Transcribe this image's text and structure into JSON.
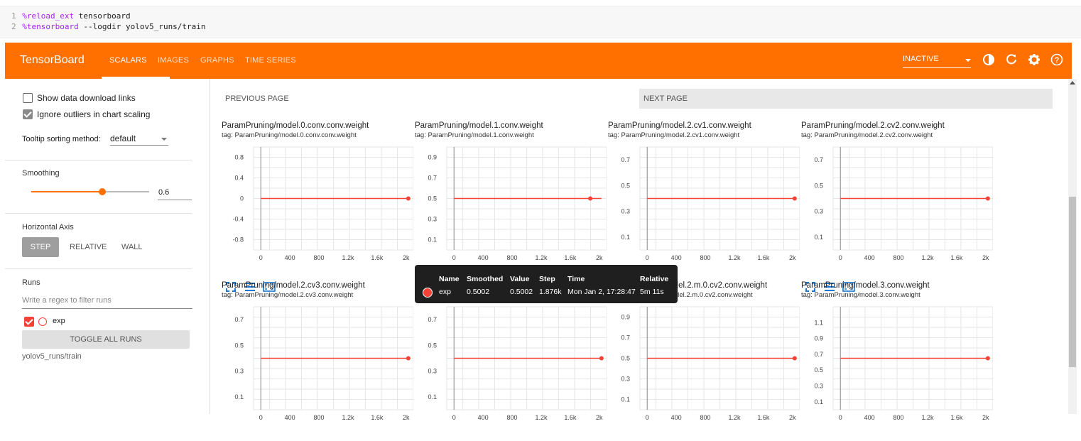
{
  "code": {
    "lines": [
      {
        "num": "1",
        "magic": "%reload_ext",
        "rest": " tensorboard"
      },
      {
        "num": "2",
        "magic": "%tensorboard",
        "rest": " --logdir yolov5_runs/train"
      }
    ]
  },
  "topbar": {
    "brand": "TensorBoard",
    "tabs": [
      "SCALARS",
      "IMAGES",
      "GRAPHS",
      "TIME SERIES"
    ],
    "status": "INACTIVE",
    "icons": [
      "brightness-icon",
      "refresh-icon",
      "settings-icon",
      "help-icon"
    ],
    "color": "#ff7000"
  },
  "sidebar": {
    "show_download": "Show data download links",
    "ignore_outliers": "Ignore outliers in chart scaling",
    "tooltip_label": "Tooltip sorting method:",
    "tooltip_value": "default",
    "smoothing_label": "Smoothing",
    "smoothing_value": "0.6",
    "smoothing_fraction": 0.6,
    "haxis_label": "Horizontal Axis",
    "haxis_options": [
      "STEP",
      "RELATIVE",
      "WALL"
    ],
    "runs_label": "Runs",
    "runs_placeholder": "Write a regex to filter runs",
    "run_name": "exp",
    "toggle_all": "TOGGLE ALL RUNS",
    "logdir": "yolov5_runs/train"
  },
  "main": {
    "prev": "PREVIOUS PAGE",
    "next": "NEXT PAGE"
  },
  "tooltip": {
    "headers": [
      "Name",
      "Smoothed",
      "Value",
      "Step",
      "Time",
      "Relative"
    ],
    "row": [
      "exp",
      "0.5002",
      "0.5002",
      "1.876k",
      "Mon Jan 2, 17:28:47",
      "5m 11s"
    ]
  },
  "chart_data": [
    {
      "type": "line",
      "title": "ParamPruning/model.0.conv.conv.weight",
      "subtitle": "tag: ParamPruning/model.0.conv.conv.weight",
      "x_ticks": [
        "0",
        "400",
        "800",
        "1.2k",
        "1.6k",
        "2k"
      ],
      "y_ticks": [
        "0.8",
        "0.4",
        "0",
        "-0.4",
        "-0.8"
      ],
      "ylim": [
        -1,
        1
      ],
      "xlim": [
        -100,
        2100
      ],
      "x": [
        0,
        2030
      ],
      "y": [
        0,
        0
      ]
    },
    {
      "type": "line",
      "title": "ParamPruning/model.1.conv.weight",
      "subtitle": "tag: ParamPruning/model.1.conv.weight",
      "x_ticks": [
        "0",
        "400",
        "800",
        "1.2k",
        "1.6k",
        "2k"
      ],
      "y_ticks": [
        "0.9",
        "0.7",
        "0.5",
        "0.3",
        "0.1"
      ],
      "ylim": [
        0,
        1
      ],
      "xlim": [
        -100,
        2100
      ],
      "x": [
        0,
        1876,
        2030
      ],
      "y": [
        0.5,
        0.5,
        0.5
      ]
    },
    {
      "type": "line",
      "title": "ParamPruning/model.2.cv1.conv.weight",
      "subtitle": "tag: ParamPruning/model.2.cv1.conv.weight",
      "x_ticks": [
        "0",
        "400",
        "800",
        "1.2k",
        "1.6k",
        "2k"
      ],
      "y_ticks": [
        "0.7",
        "0.5",
        "0.3",
        "0.1"
      ],
      "ylim": [
        0,
        0.8
      ],
      "xlim": [
        -100,
        2100
      ],
      "x": [
        0,
        2030
      ],
      "y": [
        0.4,
        0.4
      ]
    },
    {
      "type": "line",
      "title": "ParamPruning/model.2.cv2.conv.weight",
      "subtitle": "tag: ParamPruning/model.2.cv2.conv.weight",
      "x_ticks": [
        "0",
        "400",
        "800",
        "1.2k",
        "1.6k",
        "2k"
      ],
      "y_ticks": [
        "0.7",
        "0.5",
        "0.3",
        "0.1"
      ],
      "ylim": [
        0,
        0.8
      ],
      "xlim": [
        -100,
        2100
      ],
      "x": [
        0,
        2030
      ],
      "y": [
        0.4,
        0.4
      ]
    },
    {
      "type": "line",
      "title": "ParamPruning/model.2.cv3.conv.weight",
      "subtitle": "tag: ParamPruning/model.2.cv3.conv.weight",
      "x_ticks": [
        "0",
        "400",
        "800",
        "1.2k",
        "1.6k",
        "2k"
      ],
      "y_ticks": [
        "0.7",
        "0.5",
        "0.3",
        "0.1"
      ],
      "ylim": [
        0,
        0.8
      ],
      "xlim": [
        -100,
        2100
      ],
      "x": [
        0,
        2030
      ],
      "y": [
        0.4,
        0.4
      ]
    },
    {
      "type": "line",
      "title": "",
      "subtitle": "",
      "x_ticks": [
        "0",
        "400",
        "800",
        "1.2k",
        "1.6k",
        "2k"
      ],
      "y_ticks": [
        "0.7",
        "0.5",
        "0.3",
        "0.1"
      ],
      "ylim": [
        0,
        0.8
      ],
      "xlim": [
        -100,
        2100
      ],
      "x": [
        0,
        2030
      ],
      "y": [
        0.4,
        0.4
      ]
    },
    {
      "type": "line",
      "title": "ParamPruning/model.2.m.0.cv2.conv.weight",
      "subtitle": "tag: ParamPruning/model.2.m.0.cv2.conv.weight",
      "x_ticks": [
        "0",
        "400",
        "800",
        "1.2k",
        "1.6k",
        "2k"
      ],
      "y_ticks": [
        "0.9",
        "0.7",
        "0.5",
        "0.3",
        "0.1"
      ],
      "ylim": [
        0,
        1
      ],
      "xlim": [
        -100,
        2100
      ],
      "x": [
        0,
        2030
      ],
      "y": [
        0.5,
        0.5
      ]
    },
    {
      "type": "line",
      "title": "ParamPruning/model.3.conv.weight",
      "subtitle": "tag: ParamPruning/model.3.conv.weight",
      "x_ticks": [
        "0",
        "400",
        "800",
        "1.2k",
        "1.6k",
        "2k"
      ],
      "y_ticks": [
        "1.1",
        "0.9",
        "0.7",
        "0.5",
        "0.3",
        "0.1"
      ],
      "ylim": [
        0,
        1.3
      ],
      "xlim": [
        -100,
        2100
      ],
      "x": [
        0,
        2030
      ],
      "y": [
        0.65,
        0.65
      ]
    }
  ]
}
